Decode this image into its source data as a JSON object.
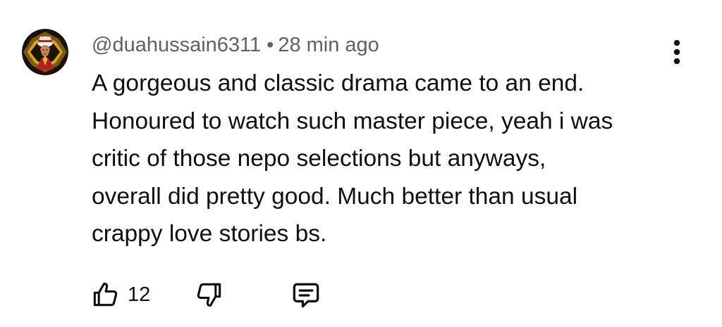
{
  "comment": {
    "author": "@duahussain6311",
    "separator": "•",
    "timestamp": "28 min ago",
    "lines": [
      "A gorgeous and classic drama came to an end.",
      "Honoured to watch such master piece, yeah i was",
      "critic of those nepo selections but anyways,",
      "overall did pretty good. Much better than usual",
      "crappy love stories bs."
    ],
    "avatar_icon": "avatar-image",
    "more_icon": "more-vert-icon"
  },
  "actions": {
    "like_icon": "thumbs-up-icon",
    "like_count": "12",
    "dislike_icon": "thumbs-down-icon",
    "reply_icon": "comment-reply-icon"
  },
  "colors": {
    "text": "#0f0f0f",
    "secondary_text": "#606060",
    "background": "#ffffff"
  }
}
